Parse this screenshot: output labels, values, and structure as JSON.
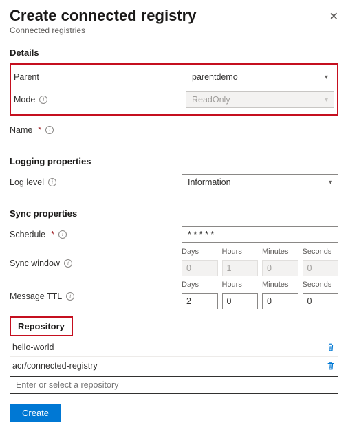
{
  "header": {
    "title": "Create connected registry",
    "subtitle": "Connected registries"
  },
  "details": {
    "section": "Details",
    "parent_label": "Parent",
    "parent_value": "parentdemo",
    "mode_label": "Mode",
    "mode_value": "ReadOnly",
    "name_label": "Name"
  },
  "logging": {
    "section": "Logging properties",
    "loglevel_label": "Log level",
    "loglevel_value": "Information"
  },
  "sync": {
    "section": "Sync properties",
    "schedule_label": "Schedule",
    "schedule_value": "* * * * *",
    "syncwindow_label": "Sync window",
    "ttl_label": "Message TTL",
    "dh": {
      "days": "Days",
      "hours": "Hours",
      "minutes": "Minutes",
      "seconds": "Seconds"
    },
    "syncwindow": {
      "days": "0",
      "hours": "1",
      "minutes": "0",
      "seconds": "0"
    },
    "ttl": {
      "days": "2",
      "hours": "0",
      "minutes": "0",
      "seconds": "0"
    }
  },
  "repo": {
    "tab": "Repository",
    "items": [
      "hello-world",
      "acr/connected-registry"
    ],
    "placeholder": "Enter or select a repository"
  },
  "actions": {
    "create": "Create"
  }
}
